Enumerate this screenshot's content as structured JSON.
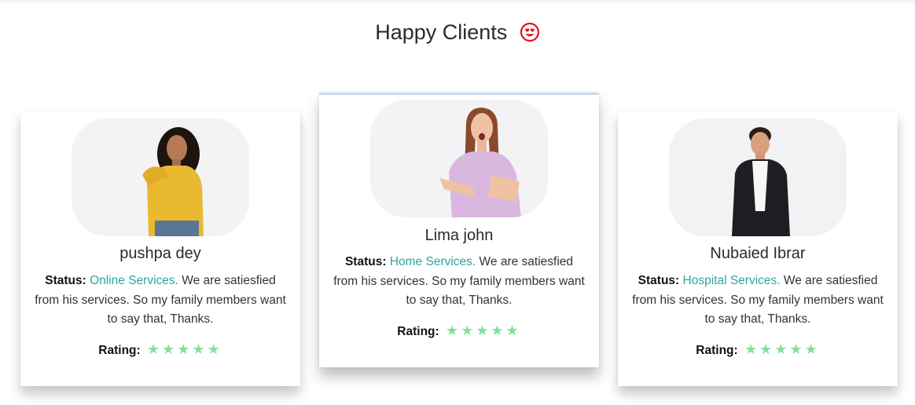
{
  "section": {
    "title": "Happy Clients",
    "emoji_icon": "heart-eyes-emoji-icon"
  },
  "colors": {
    "service_link": "#2aa6a0",
    "star": "#7fe39a",
    "emoji": "#e0141e"
  },
  "labels": {
    "status": "Status:",
    "rating": "Rating:"
  },
  "clients": [
    {
      "name": "pushpa dey",
      "service": "Online Services.",
      "text": " We are satiesfied from his services. So my family members want to say that, Thanks.",
      "stars": "★★★★★",
      "rating_value": 5
    },
    {
      "name": "Lima john",
      "service": "Home Services.",
      "text": " We are satiesfied from his services. So my family members want to say that, Thanks.",
      "stars": "★★★★★",
      "rating_value": 5
    },
    {
      "name": "Nubaied Ibrar",
      "service": "Hospital Services.",
      "text": " We are satiesfied from his services. So my family members want to say that, Thanks.",
      "stars": "★★★★★",
      "rating_value": 5
    }
  ]
}
